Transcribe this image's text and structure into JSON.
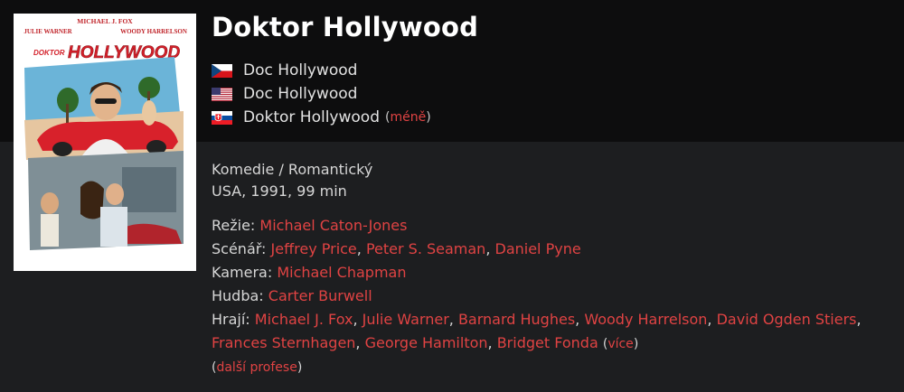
{
  "film": {
    "title": "Doktor Hollywood",
    "genres": "Komedie / Romantický",
    "origin": "USA, 1991, 99 min"
  },
  "poster": {
    "top_names_left": "MICHAEL J. FOX",
    "names_row2_left": "JULIE WARNER",
    "names_row2_right": "WOODY HARRELSON",
    "logo_small": "DOKTOR",
    "logo_big": "HOLLYWOOD"
  },
  "alt_titles": [
    {
      "flag": "czech-flag",
      "text": "Doc Hollywood"
    },
    {
      "flag": "usa-flag",
      "text": "Doc Hollywood"
    },
    {
      "flag": "slovak-flag",
      "text": "Doktor Hollywood"
    }
  ],
  "less_label": "méně",
  "creators": {
    "directing_label": "Režie:",
    "directors": [
      "Michael Caton-Jones"
    ],
    "writing_label": "Scénář:",
    "writers": [
      "Jeffrey Price",
      "Peter S. Seaman",
      "Daniel Pyne"
    ],
    "camera_label": "Kamera:",
    "camera": [
      "Michael Chapman"
    ],
    "music_label": "Hudba:",
    "music": [
      "Carter Burwell"
    ],
    "cast_label": "Hrají:",
    "cast_line1": [
      "Michael J. Fox",
      "Julie Warner",
      "Barnard Hughes",
      "Woody Harrelson",
      "David Ogden Stiers"
    ],
    "cast_line2": [
      "Frances Sternhagen",
      "George Hamilton",
      "Bridget Fonda"
    ],
    "more_label": "více",
    "other_professions_label": "další profese"
  },
  "colors": {
    "accent_link": "#e04343",
    "background": "#1d1e20",
    "header_band": "#0d0d0e"
  }
}
